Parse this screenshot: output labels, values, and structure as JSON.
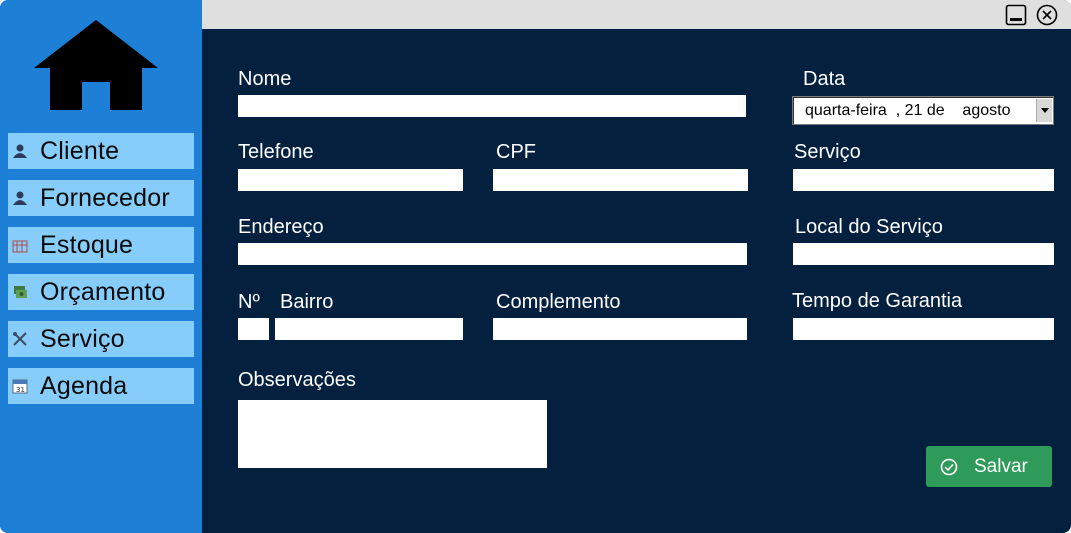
{
  "sidebar": {
    "home_icon": "home-icon",
    "items": [
      {
        "label": "Cliente",
        "icon": "person-icon"
      },
      {
        "label": "Fornecedor",
        "icon": "person-icon"
      },
      {
        "label": "Estoque",
        "icon": "warehouse-icon"
      },
      {
        "label": "Orçamento",
        "icon": "money-icon"
      },
      {
        "label": "Serviço",
        "icon": "tools-icon"
      },
      {
        "label": "Agenda",
        "icon": "calendar-icon"
      }
    ]
  },
  "titlebar": {
    "minimize_icon": "minimize-icon",
    "close_icon": "close-icon"
  },
  "form": {
    "nome": {
      "label": "Nome",
      "value": ""
    },
    "data": {
      "label": "Data",
      "value": "quarta-feira  , 21 de    agosto"
    },
    "telefone": {
      "label": "Telefone",
      "value": ""
    },
    "cpf": {
      "label": "CPF",
      "value": ""
    },
    "servico": {
      "label": "Serviço",
      "value": ""
    },
    "endereco": {
      "label": "Endereço",
      "value": ""
    },
    "local_servico": {
      "label": "Local do Serviço",
      "value": ""
    },
    "numero": {
      "label": "Nº",
      "value": ""
    },
    "bairro": {
      "label": "Bairro",
      "value": ""
    },
    "complemento": {
      "label": "Complemento",
      "value": ""
    },
    "tempo_garantia": {
      "label": "Tempo de Garantia",
      "value": ""
    },
    "observacoes": {
      "label": "Observações",
      "value": ""
    }
  },
  "save_button": {
    "label": "Salvar",
    "icon": "check-circle-icon"
  },
  "colors": {
    "sidebar": "#1e7fd6",
    "nav_item": "#87cdfb",
    "content_bg": "#03203f",
    "save": "#2e9b5b",
    "titlebar": "#dfdfdf"
  }
}
